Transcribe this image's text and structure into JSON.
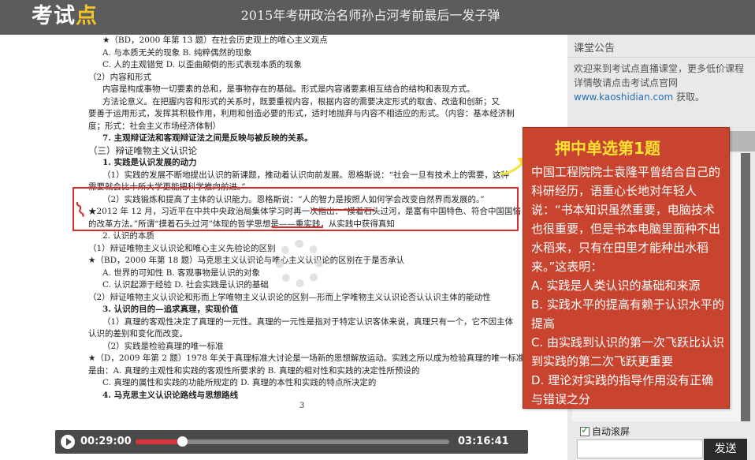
{
  "header": {
    "logo_text": "考试",
    "logo_dot": "点",
    "title": "2015年考研政治名师孙占河考前最后一发子弹"
  },
  "document": {
    "lines": [
      {
        "cls": "ln ind1",
        "text": "★（BD，2000 年第 13 题）在社会历史观上的唯心主义观点"
      },
      {
        "cls": "ln ind1",
        "text": "A. 与本质无关的现象    B. 纯粹偶然的现象"
      },
      {
        "cls": "ln ind1",
        "text": "C. 人的主观错觉          D. 以歪曲颠倒的形式表现本质的现象"
      },
      {
        "cls": "ln",
        "text": "（2）内容和形式"
      },
      {
        "cls": "ln ind1",
        "text": "内容是构成事物一切要素的总和，是事物存在的基础。形式是内容诸要素相互结合的结构和表现方式。"
      },
      {
        "cls": "ln ind1",
        "text": "方法论意义。在把握内容和形式的关系时，既要重视内容，根据内容的需要决定形式的取舍、改造和创新；又"
      },
      {
        "cls": "ln",
        "text": "要善于运用形式，发挥其积极作用，利用和创造必要的形式，适时地抛弃与内容不相适应的形式。（内容：基本经济制"
      },
      {
        "cls": "ln",
        "text": "度；形式：社会主义市场经济体制）"
      },
      {
        "cls": "ln ind1 bold",
        "text": "7. 主观辩证法和客观辩证法之间是反映与被反映的关系。"
      },
      {
        "cls": "ln h",
        "text": "（三）辩证唯物主义认识论"
      },
      {
        "cls": "ln ind1 bold",
        "text": "1. 实践是认识发展的动力"
      },
      {
        "cls": "ln ind1",
        "text": "（1）实践的发展不断地提出认识的新课题，推动着认识向前发展。恩格斯说：“社会一旦有技术上的需要，这种"
      },
      {
        "cls": "ln",
        "text": "需要就会比十所大学更能把科学推向前进。”"
      },
      {
        "cls": "ln ind1",
        "text": "（2）实践锻炼和提高了主体的认识能力。恩格斯说：“人的智力是按照人如何学会改变自然界而发展的。”"
      },
      {
        "cls": "ln",
        "text": "★2012 年 12 月，习近平在中共中央政治局集体学习时再一次指出：“摸着石头过河，是富有中国特色、符合中国国情"
      },
      {
        "cls": "ln",
        "text": "的改革方法。”所谓“摸着石头过河”体现的哲学思想是——重实践，从实践中获得真知"
      },
      {
        "cls": "ln ind1",
        "text": "2. 认识的本质"
      },
      {
        "cls": "ln",
        "text": "（1）辩证唯物主义认识论和唯心主义先验论的区别"
      },
      {
        "cls": "ln",
        "text": "★（BD，2000 年第 18 题）马克思主义认识论与唯心主义认识论的区别在于是否承认"
      },
      {
        "cls": "ln ind1",
        "text": "A. 世界的可知性                    B. 客观事物是认识的对象"
      },
      {
        "cls": "ln ind1",
        "text": "C. 认识起源于经验                  D. 社会实践是认识的基础"
      },
      {
        "cls": "ln",
        "text": "（2）辩证唯物主义认识论和形而上学唯物主义认识论的区别—形而上学唯物主义认识论否认认识主体的能动性"
      },
      {
        "cls": "ln ind1 bold",
        "text": "3. 认识的目的—追求真理，实现价值"
      },
      {
        "cls": "ln ind1",
        "text": "（1）真理的客观性决定了真理的一元性。真理的一元性是指对于特定认识客体来说，真理只有一个，它不因主体"
      },
      {
        "cls": "ln",
        "text": "认识的差别和变化而改变。"
      },
      {
        "cls": "ln ind1",
        "text": "（2）实践是检验真理的唯一标准"
      },
      {
        "cls": "ln",
        "text": "★（D，2009 年第 2 题）1978 年关于真理标准大讨论是一场新的思想解放运动。实践之所以成为检验真理的唯一标准"
      },
      {
        "cls": "ln",
        "text": "是由：A. 真理的主观性和实践的客观性所要求的          B. 真理的相对性和实践的决定性所预设的"
      },
      {
        "cls": "ln ind1",
        "text": "C. 真理的属性和实践的功能所规定的                    D. 真理的本性和实践的特点所决定的"
      },
      {
        "cls": "ln ind1 bold",
        "text": "4. 马克思主义认识论路线与思想路线"
      }
    ],
    "page_number": "3"
  },
  "player": {
    "current_time": "00:29:00",
    "total_time": "03:16:41",
    "progress": 0.1476
  },
  "right_panel": {
    "notice_title": "课堂公告",
    "notice_text": "欢迎来到考试点直播课堂，更多低价课程详情敬请点击考试点官网",
    "notice_url": "www.kaoshidian.com",
    "notice_suffix": " 获取。",
    "autoscroll_label": "自动滚屏",
    "send_label": "发送"
  },
  "callout": {
    "heading": "押中单选第1题",
    "question": "中国工程院院士袁隆平曾结合自己的科研经历，语重心长地对年轻人说：“书本知识虽然重要，电脑技术也很重要，但是书本电脑里面种不出水稻来，只有在田里才能种出水稻来。”这表明：",
    "options": [
      "A. 实践是人类认识的基础和来源",
      "B. 实践水平的提高有赖于认识水平的提高",
      "C. 由实践到认识的第一次飞跃比认识到实践的第二次飞跃更重要",
      "D. 理论对实践的指导作用没有正确与错误之分"
    ]
  },
  "colors": {
    "header_bg": "#5c5c5c",
    "accent_red": "#c8442f",
    "callout_heading": "#fde232",
    "progress_fill": "#d9353b"
  }
}
